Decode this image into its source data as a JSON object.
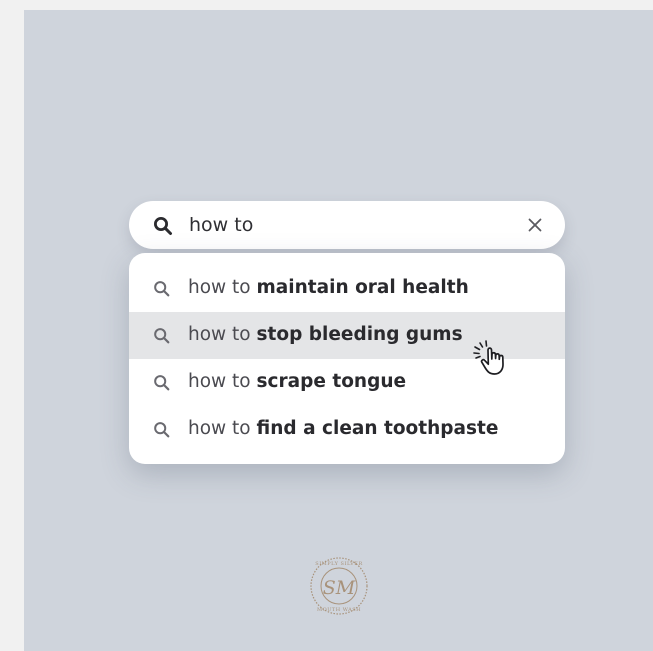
{
  "search": {
    "query": "how to",
    "clear_icon": "close-icon",
    "search_icon": "search-icon"
  },
  "suggestions": [
    {
      "prefix": "how to",
      "completion": "maintain oral health"
    },
    {
      "prefix": "how to",
      "completion": "stop bleeding gums"
    },
    {
      "prefix": "how to",
      "completion": "scrape tongue"
    },
    {
      "prefix": "how to",
      "completion": "find a clean toothpaste"
    }
  ],
  "hovered_suggestion_index": 1,
  "cursor_icon": "pointer-hand-icon",
  "brand": {
    "seal_text_top": "SIMPLY SILVER",
    "seal_text_bottom": "MOUTH WASH",
    "monogram": "SSM",
    "seal_color": "#a8927a"
  },
  "colors": {
    "panel_background": "#cfd4dc",
    "page_background": "#f1f1f1",
    "hover_row": "#e4e5e7",
    "text": "#2a2a2e"
  }
}
